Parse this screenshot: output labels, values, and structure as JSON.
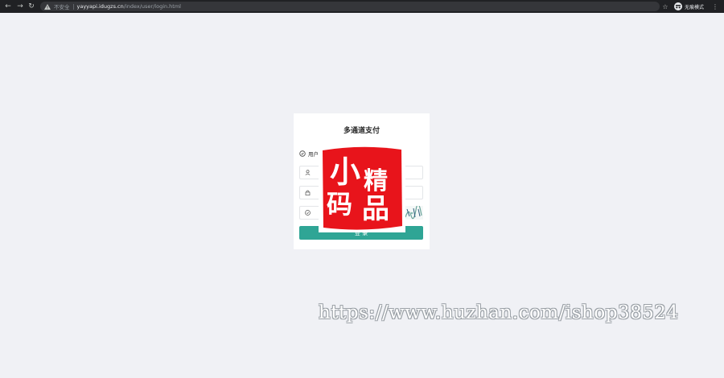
{
  "browser": {
    "security_text": "不安全",
    "url_host": "yayyapi.idugzs.cn",
    "url_path": "/index/user/login.html",
    "incognito_label": "无痕模式",
    "icons": [
      "back-arrow-icon",
      "forward-arrow-icon",
      "reload-icon",
      "warning-triangle-icon",
      "star-icon",
      "incognito-icon",
      "kebab-menu-icon"
    ]
  },
  "login": {
    "title": "多通道支付",
    "tab_label": "用户",
    "username_placeholder": "",
    "password_placeholder": "",
    "code_placeholder": "",
    "submit_label": "登 录",
    "accent_color": "#2fa595"
  },
  "watermark": {
    "seal_chars": [
      "小",
      "精",
      "码",
      "品"
    ],
    "url_text": "https://www.huzhan.com/ishop38524",
    "seal_color": "#e8141b"
  }
}
